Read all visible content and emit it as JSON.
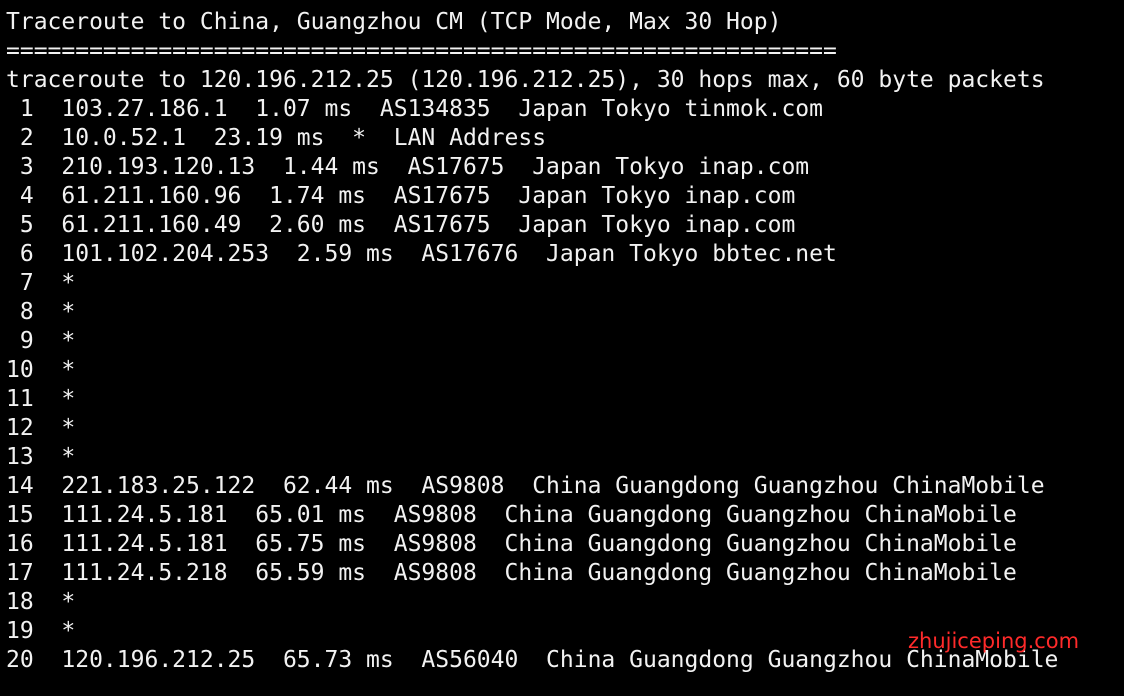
{
  "terminal": {
    "lines": [
      "Traceroute to China, Guangzhou CM (TCP Mode, Max 30 Hop)",
      "============================================================",
      "traceroute to 120.196.212.25 (120.196.212.25), 30 hops max, 60 byte packets",
      " 1  103.27.186.1  1.07 ms  AS134835  Japan Tokyo tinmok.com",
      " 2  10.0.52.1  23.19 ms  *  LAN Address",
      " 3  210.193.120.13  1.44 ms  AS17675  Japan Tokyo inap.com",
      " 4  61.211.160.96  1.74 ms  AS17675  Japan Tokyo inap.com",
      " 5  61.211.160.49  2.60 ms  AS17675  Japan Tokyo inap.com",
      " 6  101.102.204.253  2.59 ms  AS17676  Japan Tokyo bbtec.net",
      " 7  *",
      " 8  *",
      " 9  *",
      "10  *",
      "11  *",
      "12  *",
      "13  *",
      "14  221.183.25.122  62.44 ms  AS9808  China Guangdong Guangzhou ChinaMobile",
      "15  111.24.5.181  65.01 ms  AS9808  China Guangdong Guangzhou ChinaMobile",
      "16  111.24.5.181  65.75 ms  AS9808  China Guangdong Guangzhou ChinaMobile",
      "17  111.24.5.218  65.59 ms  AS9808  China Guangdong Guangzhou ChinaMobile",
      "18  *",
      "19  *",
      "20  120.196.212.25  65.73 ms  AS56040  China Guangdong Guangzhou ChinaMobile"
    ],
    "watermark": "zhujiceping.com",
    "colors": {
      "background": "#000000",
      "text": "#f2f2f2",
      "watermark": "#ff2a2a"
    }
  }
}
